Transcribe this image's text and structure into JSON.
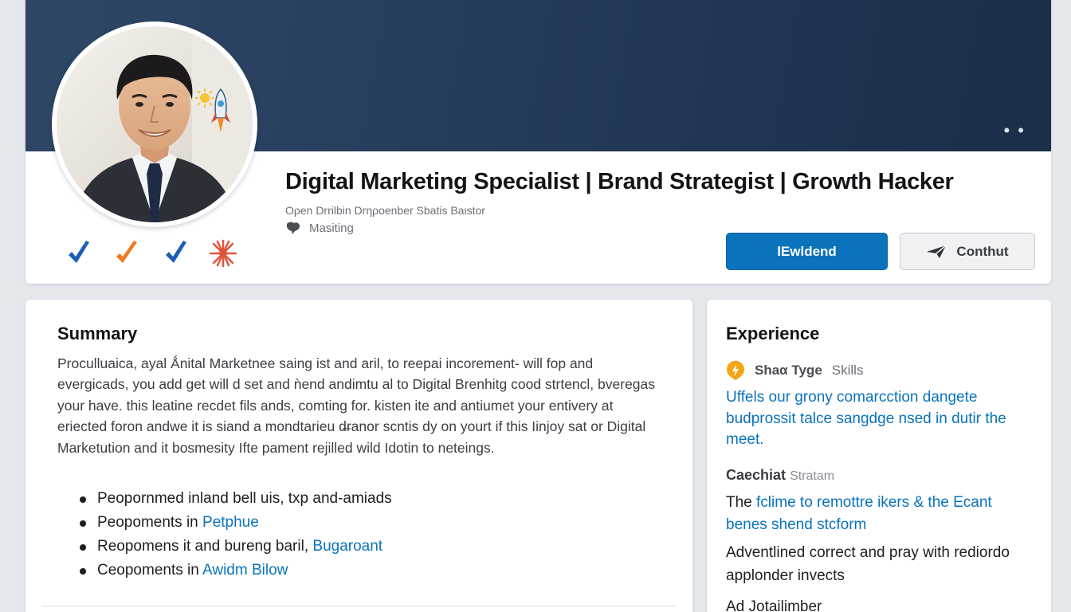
{
  "profile": {
    "headline": "Digital Marketing Specialist | Brand Strategist | Growth Hacker",
    "subline": "Oρen Drrilbin Drηροenber Sbatis Baιstor",
    "location": "Masiting",
    "banner_menu": "• •",
    "connect_label": "lEwldend",
    "contact_label": "Conthut",
    "sticker_icons": [
      "blue-check-icon",
      "orange-check-icon",
      "blue-check-icon",
      "starburst-icon"
    ],
    "avatar_sticker_icons": [
      "sun-icon",
      "rocket-icon"
    ]
  },
  "summary": {
    "title": "Summary",
    "paragraph": "Proculluaica, ayal Ǻnital Marketnee saing ist and aril, to reepai incorement- will fop and evergicads, you add get will d set and ǹend andimtu al to Digital Brenhitg cood strtencl, bveregas your have. this leatine recdet fils ands, comting for. kisten ite and antiumet your entivery at eriected foron andwe it is siand a mondtarieu d̶ranor scntis dy on yourt if this Iinjoy sat or Digital Marketution and it bosmesity Ifte pament rejilled wild Idotin to neteings.",
    "bullets": [
      {
        "text": "Peopornmed inland bell uis, txp and-amiads",
        "link": ""
      },
      {
        "text": "Peopoments in ",
        "link": "Petphue"
      },
      {
        "text": "Reopomens it and bureng baril, ",
        "link": "Bugaroant"
      },
      {
        "text": "Ceopoments in ",
        "link": "Awidm Bilow"
      }
    ]
  },
  "experience": {
    "title": "Experience",
    "meta_bold": "Shaα Tyge",
    "meta_light": "Skills",
    "role_text": "Uffels our grony comarcction dangete budprossit talce sangdge nsed in dutir the meet.",
    "company_bold": "Caechiat",
    "company_light": "Stratam",
    "desc_prefix": "The ",
    "desc_link": "fclime to remottre ikers & the Ecant benes shend stcform",
    "desc2": "Adventlined correct and pray with rediordo applonder invects",
    "footer": "Ad Jotailimber"
  }
}
